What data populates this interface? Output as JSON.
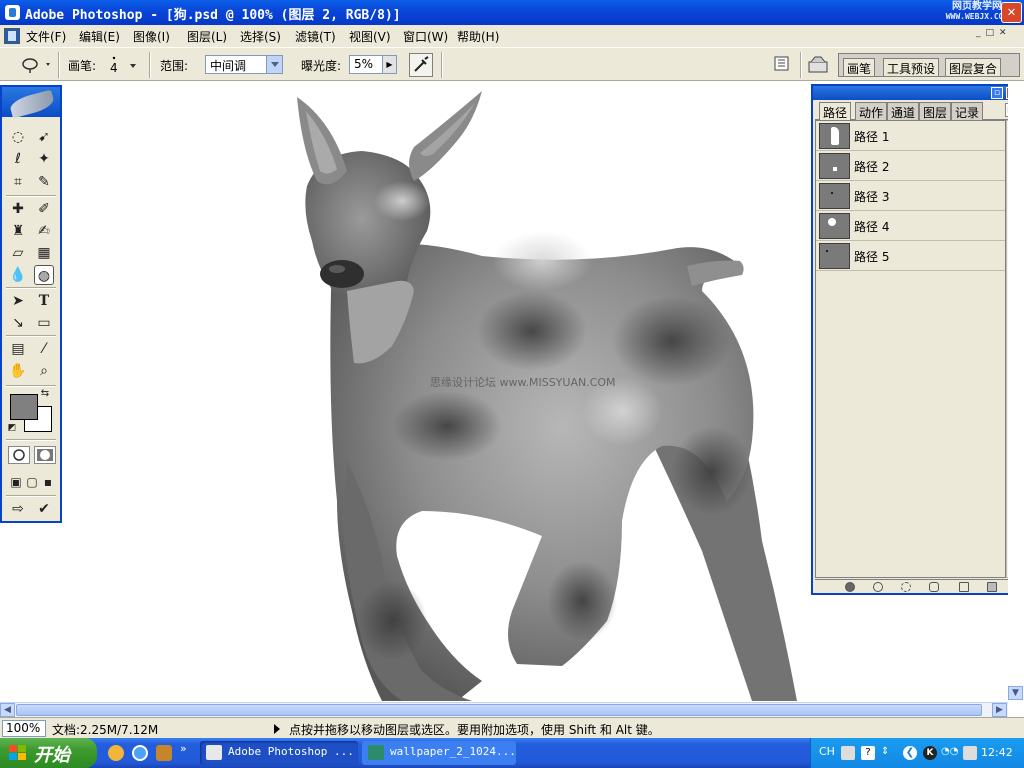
{
  "window": {
    "title": "Adobe Photoshop - [狗.psd @ 100% (图层 2, RGB/8)]",
    "watermark_line1": "网页教学网",
    "watermark_line2": "WWW.WEBJX.COM"
  },
  "menu": [
    {
      "label": "文件(F)"
    },
    {
      "label": "编辑(E)"
    },
    {
      "label": "图像(I)"
    },
    {
      "label": "图层(L)"
    },
    {
      "label": "选择(S)"
    },
    {
      "label": "滤镜(T)"
    },
    {
      "label": "视图(V)"
    },
    {
      "label": "窗口(W)"
    },
    {
      "label": "帮助(H)"
    }
  ],
  "options": {
    "brush_label": "画笔:",
    "brush_size": "4",
    "range_label": "范围:",
    "range_value": "中间调",
    "exposure_label": "曝光度:",
    "exposure_value": "5%",
    "well_tabs": [
      "画笔",
      "工具预设",
      "图层复合"
    ]
  },
  "canvas": {
    "watermark": "思缘设计论坛 www.MISSYUAN.COM"
  },
  "panel": {
    "tabs": [
      "路径",
      "动作",
      "通道",
      "图层",
      "记录"
    ],
    "active_tab": "路径",
    "paths": [
      "路径 1",
      "路径 2",
      "路径 3",
      "路径 4",
      "路径 5"
    ]
  },
  "status": {
    "zoom": "100%",
    "doc_info": "文档:2.25M/7.12M",
    "hint": "点按并拖移以移动图层或选区。要用附加选项，使用 Shift 和 Alt 键。"
  },
  "taskbar": {
    "start_label": "开始",
    "tasks": [
      "Adobe Photoshop ...",
      "wallpaper_2_1024..."
    ],
    "tray_lang": "CH",
    "clock": "12:42"
  },
  "colors": {
    "title_blue": "#0a45d8",
    "chrome_bg": "#ece9d8",
    "foreground_color": "#808080",
    "background_color": "#ffffff",
    "start_green": "#3c9a2e"
  }
}
